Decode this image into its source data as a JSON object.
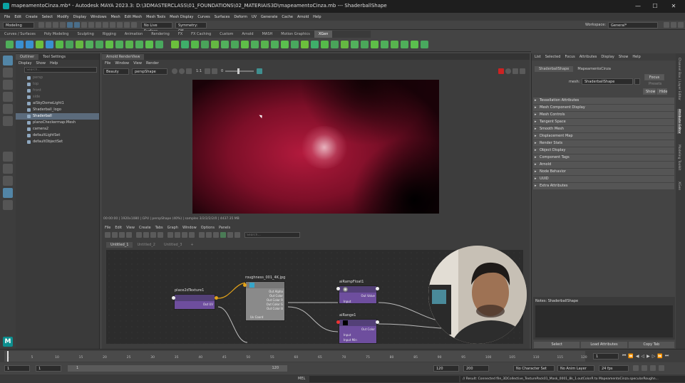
{
  "window": {
    "title": "mapeamentoCinza.mb* - Autodesk MAYA 2023.3: D:\\3DMASTERCLASS\\01_FOUNDATIONS\\02_MATERIAIS3D\\mapeamentoCinza.mb  ---  ShaderballShape"
  },
  "menubar": [
    "File",
    "Edit",
    "Create",
    "Select",
    "Modify",
    "Display",
    "Windows",
    "Mesh",
    "Edit Mesh",
    "Mesh Tools",
    "Mesh Display",
    "Curves",
    "Surfaces",
    "Deform",
    "UV",
    "Generate",
    "Cache",
    "Arnold",
    "Help"
  ],
  "statusline": {
    "mode": "Modeling",
    "live_surface": "No Live Surface",
    "symmetry": "Symmetry: Off",
    "workspace_label": "Workspace:",
    "workspace": "General*"
  },
  "shelf_tabs": [
    "Curves / Surfaces",
    "Poly Modeling",
    "Sculpting",
    "Rigging",
    "Animation",
    "Rendering",
    "FX",
    "FX Caching",
    "Custom",
    "Arnold",
    "MASH",
    "Motion Graphics",
    "XGen"
  ],
  "shelf_active": "XGen",
  "outliner": {
    "tabs": [
      "Outliner",
      "Tool Settings"
    ],
    "menus": [
      "Display",
      "Show",
      "Help"
    ],
    "search_placeholder": "Search...",
    "items": [
      {
        "label": "persp",
        "dim": true
      },
      {
        "label": "top",
        "dim": true
      },
      {
        "label": "front",
        "dim": true
      },
      {
        "label": "side",
        "dim": true
      },
      {
        "label": "aiSkyDomeLight1",
        "dim": false
      },
      {
        "label": "Shaderball_logo",
        "dim": false
      },
      {
        "label": "Shaderball",
        "dim": false,
        "selected": true
      },
      {
        "label": "planoCheckermap:Mesh",
        "dim": false
      },
      {
        "label": "camera2",
        "dim": false
      },
      {
        "label": "defaultLightSet",
        "dim": false
      },
      {
        "label": "defaultObjectSet",
        "dim": false
      }
    ]
  },
  "renderview": {
    "tab": "Arnold RenderView",
    "menus": [
      "File",
      "Window",
      "View",
      "Render"
    ],
    "aov": "Beauty",
    "camera": "perspShape",
    "ratio": "1:1",
    "exposure": "0",
    "status": "00:00:00 | 1920x1080 | GPU | perspShape (40%) | samples 3/2/2/2/2/0 | 4437.35 MB"
  },
  "hypershade": {
    "menus": [
      "File",
      "Edit",
      "View",
      "Create",
      "Tabs",
      "Graph",
      "Window",
      "Options",
      "Panels"
    ],
    "search_placeholder": "Search...",
    "tabs": [
      "Untitled_1",
      "Untitled_2",
      "Untitled_3",
      "+"
    ],
    "nodes": {
      "place2d": {
        "title": "place2dTexture1",
        "out": "Out UV"
      },
      "file": {
        "title": "roughness_001_4K.jpg",
        "ports": [
          "Out Alpha",
          "Out Color",
          "Out Color R",
          "Out Color G",
          "Out Color B"
        ],
        "input": "Uv Coord"
      },
      "ramp": {
        "title": "aiRampFloat1",
        "out": "Out Value",
        "input": "Input"
      },
      "range": {
        "title": "aiRange1",
        "out": "Out Color",
        "inputs": [
          "Input",
          "Input Min"
        ]
      }
    }
  },
  "attribute_editor": {
    "menus": [
      "List",
      "Selected",
      "Focus",
      "Attributes",
      "Display",
      "Show",
      "Help"
    ],
    "tabs": [
      "ShaderballShape",
      "MapeamentoCinza"
    ],
    "mesh_label": "mesh:",
    "mesh_value": "ShaderballShape",
    "buttons": {
      "focus": "Focus",
      "presets": "Presets",
      "show": "Show",
      "hide": "Hide"
    },
    "sections": [
      "Tessellation Attributes",
      "Mesh Component Display",
      "Mesh Controls",
      "Tangent Space",
      "Smooth Mesh",
      "Displacement Map",
      "Render Stats",
      "Object Display",
      "Component Tags",
      "Arnold",
      "Node Behavior",
      "UUID",
      "Extra Attributes"
    ],
    "notes_label": "Notes: ShaderballShape",
    "bottom_buttons": [
      "Select",
      "Load Attributes",
      "Copy Tab"
    ]
  },
  "side_tabs": [
    "Channel Box / Layer Editor",
    "Attribute Editor",
    "Modeling Toolkit",
    "XGen"
  ],
  "timeline": {
    "ticks": [
      "1",
      "5",
      "10",
      "15",
      "20",
      "25",
      "30",
      "35",
      "40",
      "45",
      "50",
      "55",
      "60",
      "65",
      "70",
      "75",
      "80",
      "85",
      "90",
      "95",
      "100",
      "105",
      "110",
      "115",
      "120"
    ],
    "current": "1"
  },
  "range": {
    "start": "1",
    "start2": "1",
    "slider_val": "1",
    "slider_end": "120",
    "end": "120",
    "end2": "200",
    "char_set": "No Character Set",
    "anim_layer": "No Anim Layer",
    "fps": "24 fps"
  },
  "cmdline": {
    "lang": "MEL",
    "result": "// Result: Connected file_3DCollective_TexturePack01_Mask_0001_8k_1.outColorR to MapeamentoCinza.specularRoughn..."
  },
  "colors": {
    "selection": "#5b6b7c",
    "node_purple": "#6e4e9e",
    "render_red": "#b31a3d",
    "accent_blue": "#5285a6"
  }
}
